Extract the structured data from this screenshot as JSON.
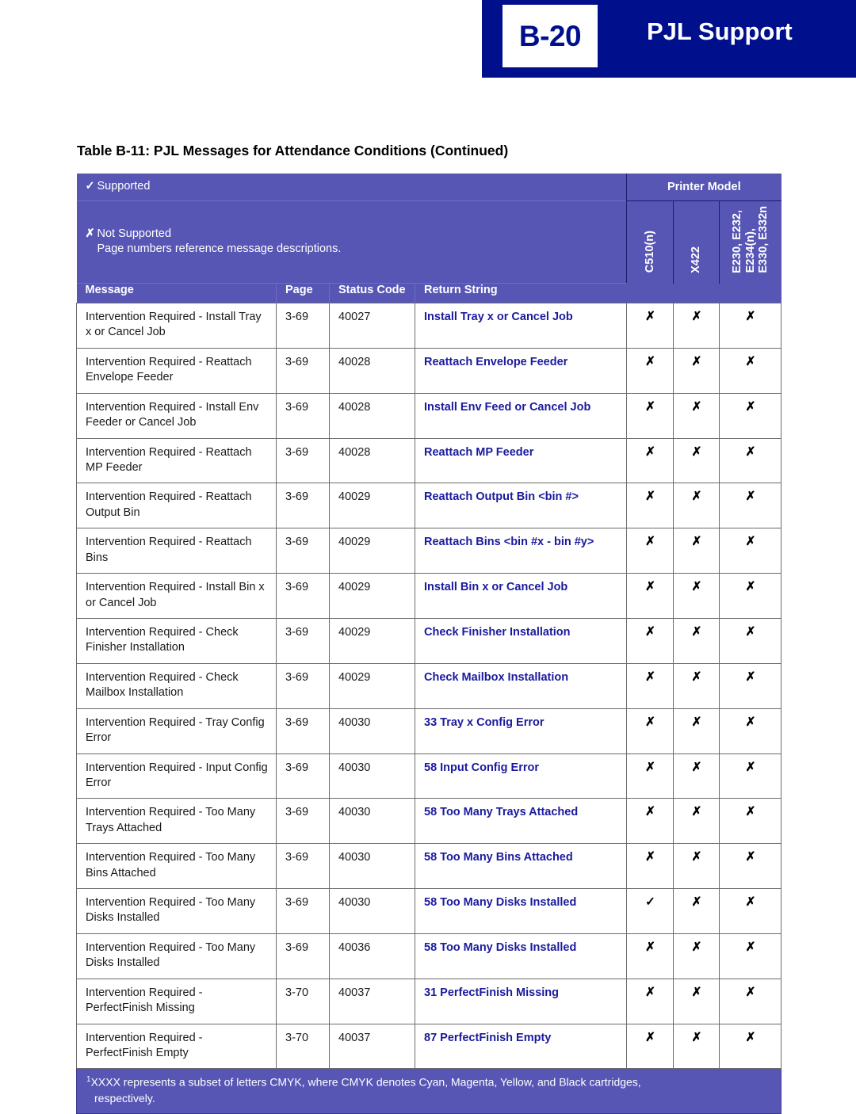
{
  "banner": {
    "page_number": "B-20",
    "title": "PJL Support"
  },
  "caption": "Table B-11:  PJL Messages for Attendance Conditions (Continued)",
  "legend": {
    "supported_mark": "✓",
    "supported_label": "Supported",
    "not_supported_mark": "✗",
    "not_supported_label": "Not Supported",
    "note": "Page numbers reference message descriptions."
  },
  "group_header": "Printer Model",
  "columns": {
    "message": "Message",
    "page": "Page",
    "status_code": "Status Code",
    "return_string": "Return String",
    "c510": "C510(n)",
    "x422": "X422",
    "e230_line1": "E230, E232,",
    "e230_line2": "E234(n),",
    "e230_line3": "E330, E332n"
  },
  "rows": [
    {
      "message": "Intervention Required - Install Tray x or Cancel Job",
      "page": "3-69",
      "status_code": "40027",
      "return_string": "Install Tray x or Cancel Job",
      "c510": "✗",
      "x422": "✗",
      "e230": "✗"
    },
    {
      "message": "Intervention Required - Reattach Envelope Feeder",
      "page": "3-69",
      "status_code": "40028",
      "return_string": "Reattach Envelope Feeder",
      "c510": "✗",
      "x422": "✗",
      "e230": "✗"
    },
    {
      "message": "Intervention Required - Install Env Feeder or Cancel Job",
      "page": "3-69",
      "status_code": "40028",
      "return_string": "Install Env Feed or Cancel Job",
      "c510": "✗",
      "x422": "✗",
      "e230": "✗"
    },
    {
      "message": "Intervention Required - Reattach MP Feeder",
      "page": "3-69",
      "status_code": "40028",
      "return_string": "Reattach MP Feeder",
      "c510": "✗",
      "x422": "✗",
      "e230": "✗"
    },
    {
      "message": "Intervention Required - Reattach Output Bin",
      "page": "3-69",
      "status_code": "40029",
      "return_string": "Reattach Output Bin <bin #>",
      "c510": "✗",
      "x422": "✗",
      "e230": "✗"
    },
    {
      "message": "Intervention Required - Reattach Bins",
      "page": "3-69",
      "status_code": "40029",
      "return_string": "Reattach Bins <bin #x - bin #y>",
      "c510": "✗",
      "x422": "✗",
      "e230": "✗"
    },
    {
      "message": "Intervention Required - Install Bin x or Cancel Job",
      "page": "3-69",
      "status_code": "40029",
      "return_string": "Install Bin x or Cancel Job",
      "c510": "✗",
      "x422": "✗",
      "e230": "✗"
    },
    {
      "message": "Intervention Required - Check Finisher Installation",
      "page": "3-69",
      "status_code": "40029",
      "return_string": "Check Finisher Installation",
      "c510": "✗",
      "x422": "✗",
      "e230": "✗"
    },
    {
      "message": "Intervention Required - Check Mailbox Installation",
      "page": "3-69",
      "status_code": "40029",
      "return_string": "Check Mailbox Installation",
      "c510": "✗",
      "x422": "✗",
      "e230": "✗"
    },
    {
      "message": "Intervention Required - Tray Config Error",
      "page": "3-69",
      "status_code": "40030",
      "return_string": "33 Tray x Config Error",
      "c510": "✗",
      "x422": "✗",
      "e230": "✗"
    },
    {
      "message": "Intervention Required - Input Config Error",
      "page": "3-69",
      "status_code": "40030",
      "return_string": "58 Input Config Error",
      "c510": "✗",
      "x422": "✗",
      "e230": "✗"
    },
    {
      "message": "Intervention Required - Too Many Trays Attached",
      "page": "3-69",
      "status_code": "40030",
      "return_string": "58 Too Many Trays Attached",
      "c510": "✗",
      "x422": "✗",
      "e230": "✗"
    },
    {
      "message": "Intervention Required - Too Many Bins Attached",
      "page": "3-69",
      "status_code": "40030",
      "return_string": "58 Too Many Bins Attached",
      "c510": "✗",
      "x422": "✗",
      "e230": "✗"
    },
    {
      "message": "Intervention Required - Too Many Disks Installed",
      "page": "3-69",
      "status_code": "40030",
      "return_string": "58 Too Many Disks Installed",
      "c510": "✓",
      "x422": "✗",
      "e230": "✗"
    },
    {
      "message": "Intervention Required - Too Many Disks Installed",
      "page": "3-69",
      "status_code": "40036",
      "return_string": "58 Too Many Disks Installed",
      "c510": "✗",
      "x422": "✗",
      "e230": "✗"
    },
    {
      "message": "Intervention Required - PerfectFinish Missing",
      "page": "3-70",
      "status_code": "40037",
      "return_string": "31 PerfectFinish Missing",
      "c510": "✗",
      "x422": "✗",
      "e230": "✗"
    },
    {
      "message": "Intervention Required - PerfectFinish Empty",
      "page": "3-70",
      "status_code": "40037",
      "return_string": "87 PerfectFinish Empty",
      "c510": "✗",
      "x422": "✗",
      "e230": "✗"
    }
  ],
  "footnote": {
    "marker": "1",
    "line1": "XXXX represents a subset of letters CMYK, where CMYK denotes Cyan, Magenta, Yellow, and Black cartridges,",
    "line2": "respectively."
  },
  "colors": {
    "banner_navy": "#000f8c",
    "header_indigo": "#5756b5",
    "return_string_blue": "#1a1a9e",
    "grid_gray": "#6b6b6b"
  }
}
